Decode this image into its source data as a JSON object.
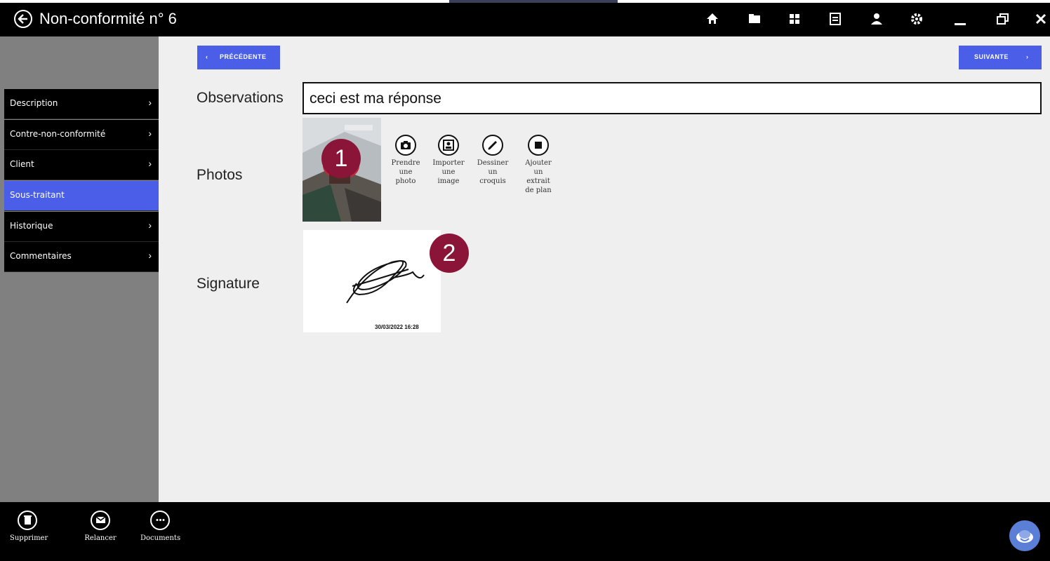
{
  "window": {
    "title": "Non-conformité n° 6",
    "toolbar_icons": [
      "home-icon",
      "folder-icon",
      "grid-icon",
      "document-icon",
      "user-icon",
      "settings-icon",
      "minimize-icon",
      "restore-icon",
      "close-icon"
    ]
  },
  "sidebar": {
    "items": [
      {
        "label": "Description",
        "active": false
      },
      {
        "label": "Contre-non-conformité",
        "active": false
      },
      {
        "label": "Client",
        "active": false
      },
      {
        "label": "Sous-traitant",
        "active": true
      },
      {
        "label": "Historique",
        "active": false
      },
      {
        "label": "Commentaires",
        "active": false
      }
    ]
  },
  "pager": {
    "previous_label": "PRÉCÉDENTE",
    "next_label": "SUIVANTE"
  },
  "form": {
    "observations_label": "Observations",
    "observations_value": "ceci est ma réponse",
    "photos_label": "Photos",
    "signature_label": "Signature",
    "signature_date": "30/03/2022 16:28"
  },
  "photo_actions": [
    {
      "label_lines": [
        "Prendre",
        "une",
        "photo"
      ],
      "icon": "camera-icon"
    },
    {
      "label_lines": [
        "Importer",
        "une",
        "image"
      ],
      "icon": "image-import-icon"
    },
    {
      "label_lines": [
        "Dessiner",
        "un",
        "croquis"
      ],
      "icon": "pencil-icon"
    },
    {
      "label_lines": [
        "Ajouter",
        "un",
        "extrait",
        "de plan"
      ],
      "icon": "plan-icon"
    }
  ],
  "badges": [
    "1",
    "2"
  ],
  "bottom_actions": [
    {
      "label": "Supprimer",
      "icon": "trash-icon"
    },
    {
      "label": "Relancer",
      "icon": "mail-icon"
    },
    {
      "label": "Documents",
      "icon": "more-icon"
    }
  ],
  "colors": {
    "accent": "#4a5ee8",
    "badge": "#8b1538",
    "titlebar": "#000000",
    "sidebar": "#808080",
    "main_bg": "#efefef"
  }
}
